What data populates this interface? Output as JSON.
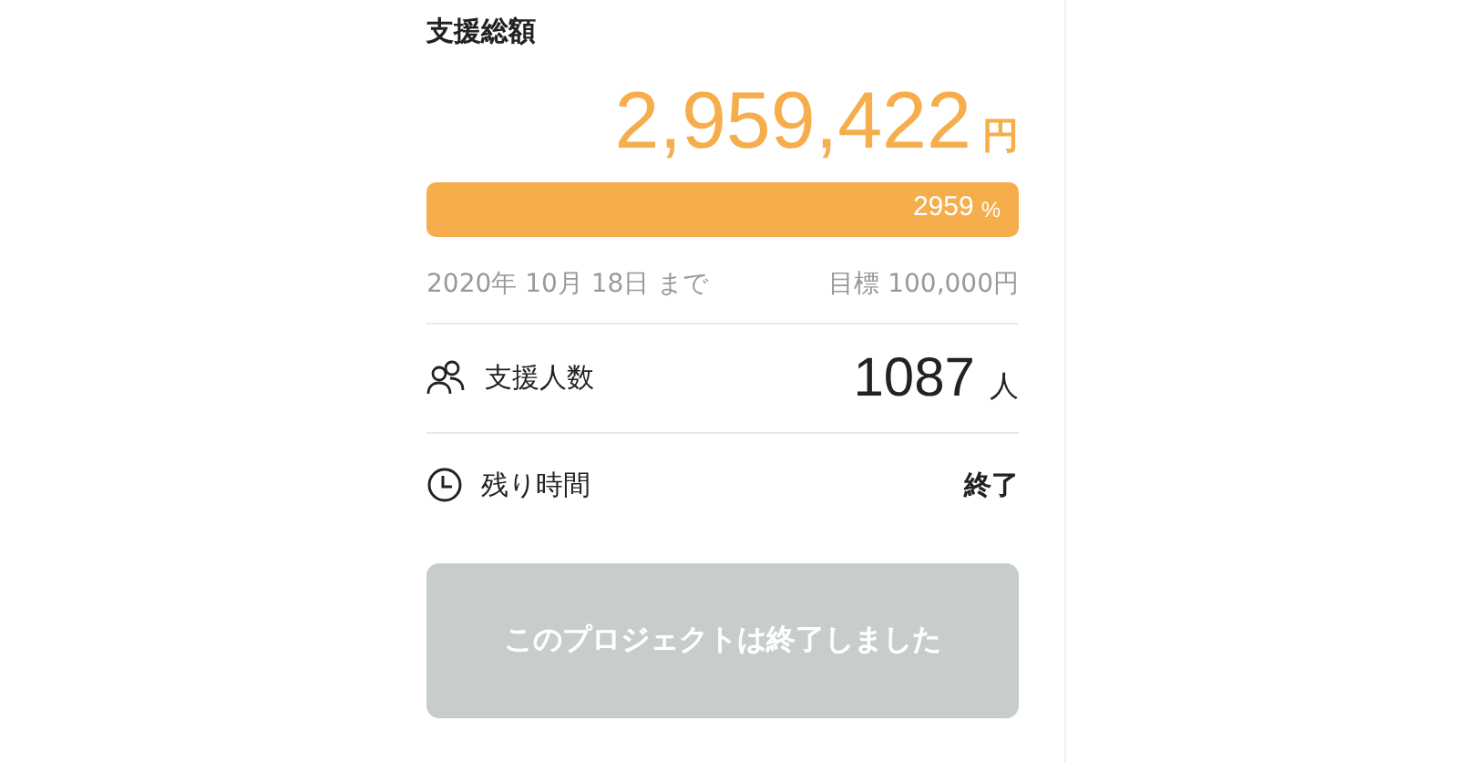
{
  "title": "支援総額",
  "amount": {
    "value": "2,959,422",
    "unit": "円"
  },
  "progress": {
    "level": 1,
    "label": "2959",
    "unit": "%"
  },
  "deadline": "2020年 10月 18日 まで",
  "goal": "目標 100,000円",
  "stats": [
    {
      "kind": "people",
      "label": "支援人数",
      "value": "1087",
      "unit": "人"
    },
    {
      "kind": "time",
      "label": "残り時間",
      "value": "終了"
    }
  ],
  "button": {
    "label": "このプロジェクトは終了しました",
    "disabled": true
  }
}
